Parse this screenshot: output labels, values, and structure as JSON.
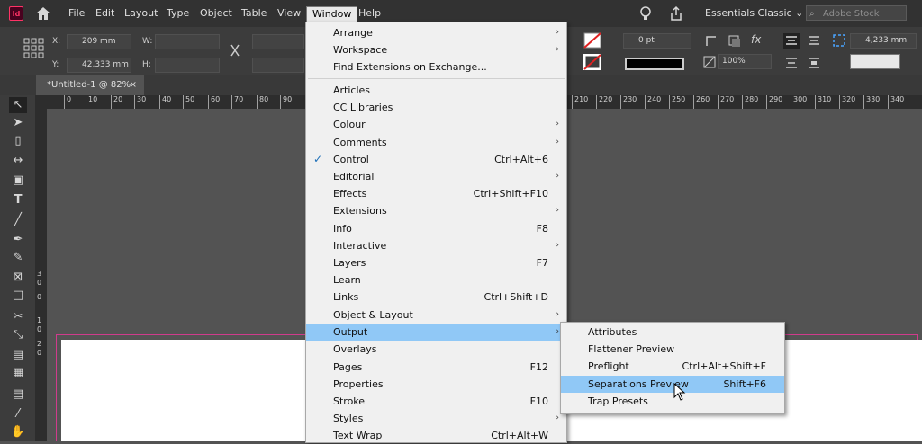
{
  "app": {
    "logo": "Id"
  },
  "menubar": {
    "items": [
      "File",
      "Edit",
      "Layout",
      "Type",
      "Object",
      "Table",
      "View",
      "Window",
      "Help"
    ],
    "workspace": "Essentials Classic",
    "search_placeholder": "Adobe Stock"
  },
  "control": {
    "x_label": "X:",
    "x_value": "209 mm",
    "y_label": "Y:",
    "y_value": "42,333 mm",
    "w_label": "W:",
    "h_label": "H:",
    "stroke_weight": "0 pt",
    "opacity": "100%",
    "ref_value": "4,233 mm"
  },
  "document": {
    "tab_label": "*Untitled-1 @ 82%",
    "close": "×"
  },
  "ruler": {
    "ticks": [
      "0",
      "10",
      "20",
      "30",
      "40",
      "50",
      "60",
      "70",
      "80",
      "90",
      "210",
      "220",
      "230",
      "240",
      "250",
      "260",
      "270",
      "280",
      "290",
      "300",
      "310",
      "320",
      "330",
      "340"
    ]
  },
  "vruler": {
    "ticks": [
      "3",
      "0",
      "0",
      "1",
      "0",
      "2",
      "0"
    ]
  },
  "window_menu": {
    "items": [
      {
        "label": "Arrange",
        "shortcut": "",
        "submenu": true
      },
      {
        "label": "Workspace",
        "shortcut": "",
        "submenu": true
      },
      {
        "label": "Find Extensions on Exchange...",
        "shortcut": "",
        "submenu": false
      },
      {
        "label": "Articles",
        "shortcut": "",
        "submenu": false
      },
      {
        "label": "CC Libraries",
        "shortcut": "",
        "submenu": false
      },
      {
        "label": "Colour",
        "shortcut": "",
        "submenu": true
      },
      {
        "label": "Comments",
        "shortcut": "",
        "submenu": true
      },
      {
        "label": "Control",
        "shortcut": "Ctrl+Alt+6",
        "submenu": false,
        "checked": true
      },
      {
        "label": "Editorial",
        "shortcut": "",
        "submenu": true
      },
      {
        "label": "Effects",
        "shortcut": "Ctrl+Shift+F10",
        "submenu": false
      },
      {
        "label": "Extensions",
        "shortcut": "",
        "submenu": true
      },
      {
        "label": "Info",
        "shortcut": "F8",
        "submenu": false
      },
      {
        "label": "Interactive",
        "shortcut": "",
        "submenu": true
      },
      {
        "label": "Layers",
        "shortcut": "F7",
        "submenu": false
      },
      {
        "label": "Learn",
        "shortcut": "",
        "submenu": false
      },
      {
        "label": "Links",
        "shortcut": "Ctrl+Shift+D",
        "submenu": false
      },
      {
        "label": "Object & Layout",
        "shortcut": "",
        "submenu": true
      },
      {
        "label": "Output",
        "shortcut": "",
        "submenu": true,
        "highlighted": true
      },
      {
        "label": "Overlays",
        "shortcut": "",
        "submenu": false
      },
      {
        "label": "Pages",
        "shortcut": "F12",
        "submenu": false
      },
      {
        "label": "Properties",
        "shortcut": "",
        "submenu": false
      },
      {
        "label": "Stroke",
        "shortcut": "F10",
        "submenu": false
      },
      {
        "label": "Styles",
        "shortcut": "",
        "submenu": true
      },
      {
        "label": "Text Wrap",
        "shortcut": "Ctrl+Alt+W",
        "submenu": false
      }
    ]
  },
  "output_submenu": {
    "items": [
      {
        "label": "Attributes",
        "shortcut": ""
      },
      {
        "label": "Flattener Preview",
        "shortcut": ""
      },
      {
        "label": "Preflight",
        "shortcut": "Ctrl+Alt+Shift+F"
      },
      {
        "label": "Separations Preview",
        "shortcut": "Shift+F6",
        "highlighted": true
      },
      {
        "label": "Trap Presets",
        "shortcut": ""
      }
    ]
  },
  "colors": {
    "highlight": "#90c8f6",
    "menubar": "#323232",
    "pasteboard": "#535353",
    "page_border": "#d03b8c"
  }
}
